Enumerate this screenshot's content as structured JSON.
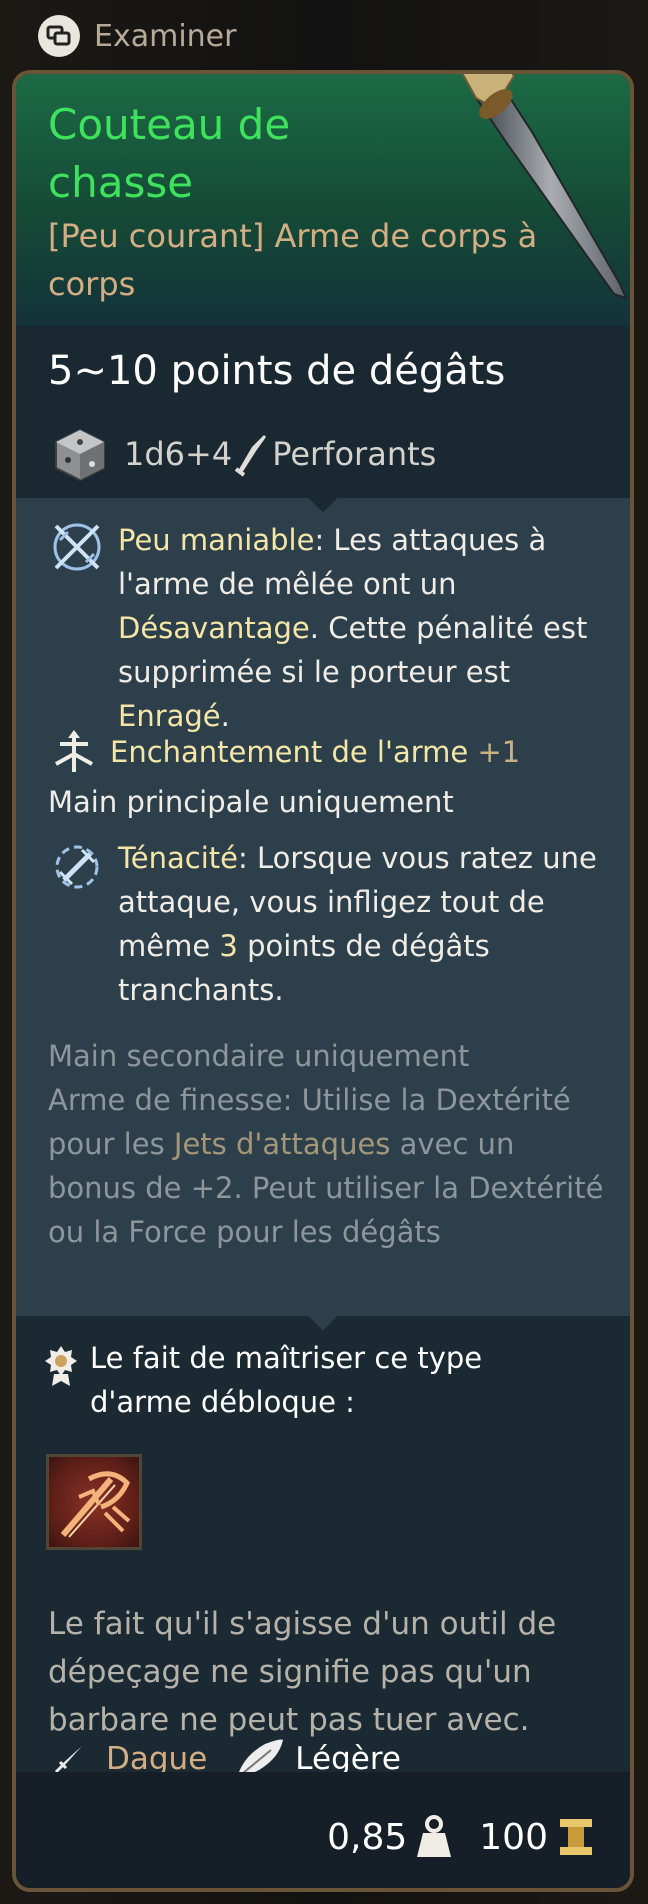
{
  "header": {
    "control_label": "Examiner",
    "button_icon": "controller-button-icon"
  },
  "item": {
    "name": "Couteau de chasse",
    "subtitle": "[Peu courant] Arme de corps à corps",
    "image_icon": "hunting-knife-icon"
  },
  "damage": {
    "line": "5~10 points de dégâts",
    "dice": "1d6+4",
    "type": "Perforants"
  },
  "properties": {
    "unwieldy": {
      "name": "Peu maniable",
      "colon": ":",
      "text1": " Les attaques à l'arme de mêlée ont un ",
      "disadv": "Désavantage",
      "text2": ". Cette pénalité est supprimée si le porteur est ",
      "enraged": "Enragé",
      "text3": "."
    },
    "enchant": {
      "label": "Enchantement de l'arme",
      "bonus": "+1"
    },
    "main_hand": "Main principale uniquement",
    "tenacity": {
      "name": "Ténacité",
      "colon": ":",
      "text1": " Lorsque vous ratez une attaque, vous infligez tout de même ",
      "value": "3",
      "text2": " points de dégâts tranchants."
    },
    "off_hand": "Main secondaire uniquement",
    "finesse": {
      "text1": "Arme de finesse: Utilise la Dextérité pour les ",
      "link": "Jets d'attaques",
      "text2": " avec un bonus de +2. Peut utiliser la Dextérité ou la Force pour les dégâts"
    }
  },
  "mastery": {
    "text": "Le fait de maîtriser ce type d'arme débloque :",
    "skill_icon": "blade-slash-skill-icon"
  },
  "flavor": "Le fait qu'il s'agisse d'un outil de dépeçage ne signifie pas qu'un barbare ne peut pas tuer avec.",
  "tags": {
    "weapon_type": "Dague",
    "weight_class": "Légère"
  },
  "footer": {
    "weight": "0,85",
    "price": "100"
  },
  "colors": {
    "title_green": "#3fe25c",
    "subtitle_orange": "#d3ae84",
    "keyword_yellow": "#f3e6a6",
    "border_gold": "#6a5437"
  }
}
